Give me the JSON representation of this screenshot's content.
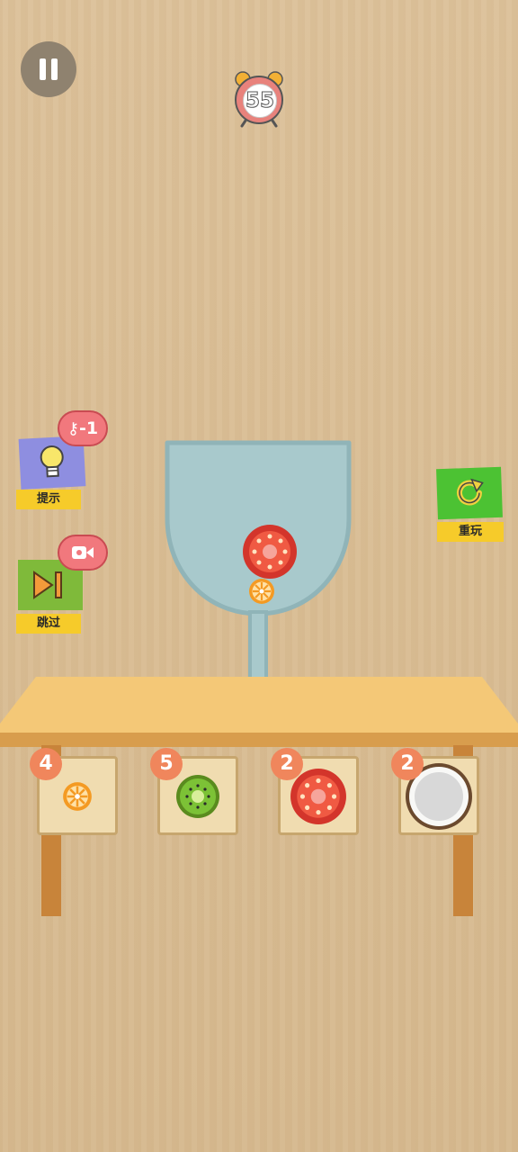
{
  "hud": {
    "timer_value": "55"
  },
  "buttons": {
    "hint_label": "提示",
    "hint_cost": "-1",
    "skip_label": "跳过",
    "replay_label": "重玩"
  },
  "glass_items": [
    "tomato",
    "orange"
  ],
  "shelf": {
    "slots": [
      {
        "fruit": "orange",
        "count": "4"
      },
      {
        "fruit": "kiwi",
        "count": "5"
      },
      {
        "fruit": "tomato",
        "count": "2"
      },
      {
        "fruit": "coconut",
        "count": "2"
      }
    ]
  },
  "icons": {
    "pause": "pause-icon",
    "timer": "alarm-clock-icon",
    "hint": "lightbulb-icon",
    "key": "key-icon",
    "skip": "skip-forward-icon",
    "video": "video-camera-icon",
    "replay": "refresh-icon"
  },
  "colors": {
    "label_yellow": "#f6cb2a",
    "badge_orange": "#f0865c",
    "replay_green": "#4cc233",
    "hint_purple": "#8e8ee0",
    "bubble_pink": "#f1787d",
    "glass_water": "#a8c9cc"
  }
}
